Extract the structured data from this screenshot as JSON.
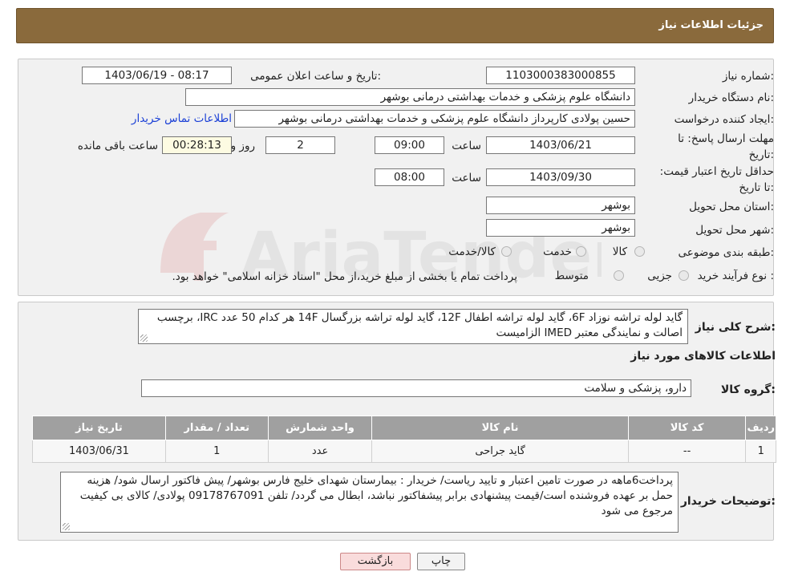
{
  "header": {
    "title": "جزئیات اطلاعات نیاز"
  },
  "form": {
    "need_number_label": "شماره نیاز:",
    "need_number": "1103000383000855",
    "announce_label": "تاریخ و ساعت اعلان عمومی:",
    "announce_value": "1403/06/19 - 08:17",
    "buyer_org_label": "نام دستگاه خریدار:",
    "buyer_org": "دانشگاه علوم پزشکی و خدمات بهداشتی درمانی بوشهر",
    "requester_label": "ایجاد کننده درخواست:",
    "requester": "حسین پولادی کارپرداز دانشگاه علوم پزشکی و خدمات بهداشتی درمانی بوشهر",
    "contact_link": "اطلاعات تماس خریدار",
    "deadline_label": "مهلت ارسال پاسخ: تا تاریخ:",
    "deadline_date": "1403/06/21",
    "time_label": "ساعت",
    "deadline_time": "09:00",
    "days_value": "2",
    "days_label": "روز و",
    "remaining_value": "00:28:13",
    "remaining_label": "ساعت باقی مانده",
    "validity_label": "حداقل تاریخ اعتبار قیمت: تا تاریخ:",
    "validity_date": "1403/09/30",
    "validity_time_label": "ساعت",
    "validity_time": "08:00",
    "province_label": "استان محل تحویل:",
    "province": "بوشهر",
    "city_label": "شهر محل تحویل:",
    "city": "بوشهر",
    "category_label": "طبقه بندی موضوعی:",
    "category_options": [
      "کالا",
      "خدمت",
      "کالا/خدمت"
    ],
    "process_label": "نوع فرآیند خرید :",
    "process_options": [
      "جزیی",
      "متوسط"
    ],
    "process_note": "پرداخت تمام یا بخشی از مبلغ خرید،از محل \"اسناد خزانه اسلامی\" خواهد بود."
  },
  "summary": {
    "label": "شرح کلی نیاز:",
    "text": "گاید لوله تراشه نوزاد 6F، گاید لوله تراشه اطفال 12F، گاید لوله تراشه بزرگسال 14F هر کدام 50 عدد IRC، برچسب اصالت و نمایندگی معتبر IMED الزامیست"
  },
  "goods": {
    "section_title": "اطلاعات کالاهای مورد نیاز",
    "group_label": "گروه کالا:",
    "group_value": "دارو، پزشکی و سلامت",
    "table": {
      "headers": [
        "ردیف",
        "کد کالا",
        "نام کالا",
        "واحد شمارش",
        "تعداد / مقدار",
        "تاریخ نیاز"
      ],
      "rows": [
        [
          "1",
          "--",
          "گاید جراحی",
          "عدد",
          "1",
          "1403/06/31"
        ]
      ]
    }
  },
  "buyer_notes": {
    "label": "توضیحات خریدار:",
    "text": "پرداخت6ماهه در صورت تامین اعتبار و تایید ریاست/ خریدار : بیمارستان شهدای خلیج فارس بوشهر/ پیش فاکتور ارسال شود/ هزینه حمل بر عهده فروشنده است/قیمت پیشنهادی برابر پیشفاکتور نباشد، ابطال می گردد/ تلفن 09178767091 پولادی/ کالای بی کیفیت مرجوع می شود"
  },
  "buttons": {
    "print": "چاپ",
    "back": "بازگشت"
  },
  "watermark_text": "AriaTender.neT",
  "colors": {
    "header": "#8a6a3c",
    "link": "#1a3fd6",
    "table_header": "#a0a0a0",
    "back_button": "#f9dcdc"
  }
}
